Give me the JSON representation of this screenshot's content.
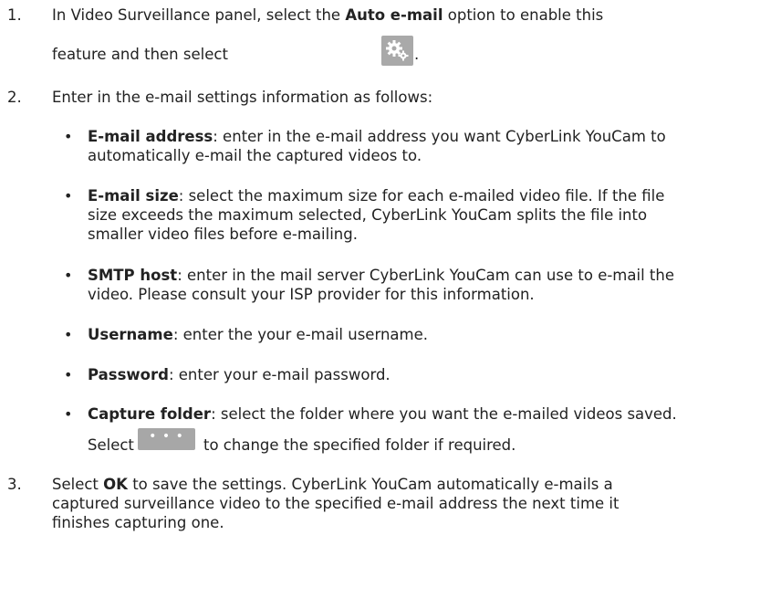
{
  "steps": [
    {
      "number": "1.",
      "line1_pre": "In Video Surveillance panel, select the ",
      "line1_bold": "Auto e-mail",
      "line1_post": " option to enable this",
      "line2_pre": "feature and then select",
      "line2_post": "."
    },
    {
      "number": "2.",
      "text": "Enter in the e-mail settings information as follows:"
    },
    {
      "number": "3.",
      "line1_pre": "Select ",
      "line1_bold": "OK",
      "line1_post": " to save the settings. CyberLink YouCam automatically e-mails a",
      "line2": "captured surveillance video to the specified e-mail address the next time it",
      "line3": "finishes capturing one."
    }
  ],
  "bullet_char": "•",
  "bullets": [
    {
      "label": "E-mail address",
      "line1": ": enter in the e-mail address you want CyberLink YouCam to",
      "line2": "automatically e-mail the captured videos to."
    },
    {
      "label": "E-mail size",
      "line1": ": select the maximum size for each e-mailed video file. If the file",
      "line2": "size exceeds the maximum selected, CyberLink YouCam splits the file into",
      "line3": "smaller video files before e-mailing."
    },
    {
      "label": "SMTP host",
      "line1": ": enter in the mail server CyberLink YouCam can use to e-mail the",
      "line2": "video. Please consult your ISP provider for this information."
    },
    {
      "label": "Username",
      "line1": ": enter the your e-mail username."
    },
    {
      "label": "Password",
      "line1": ": enter your e-mail password."
    },
    {
      "label": "Capture folder",
      "line1": ": select the folder where you want the e-mailed videos saved.",
      "line2_pre": "Select",
      "line2_post": "to change the specified folder if required."
    }
  ],
  "icons": {
    "settings_button": "gears-icon",
    "browse_button": "ellipsis-icon",
    "browse_glyph": "• • •",
    "button_color": "#a9a9a9"
  }
}
